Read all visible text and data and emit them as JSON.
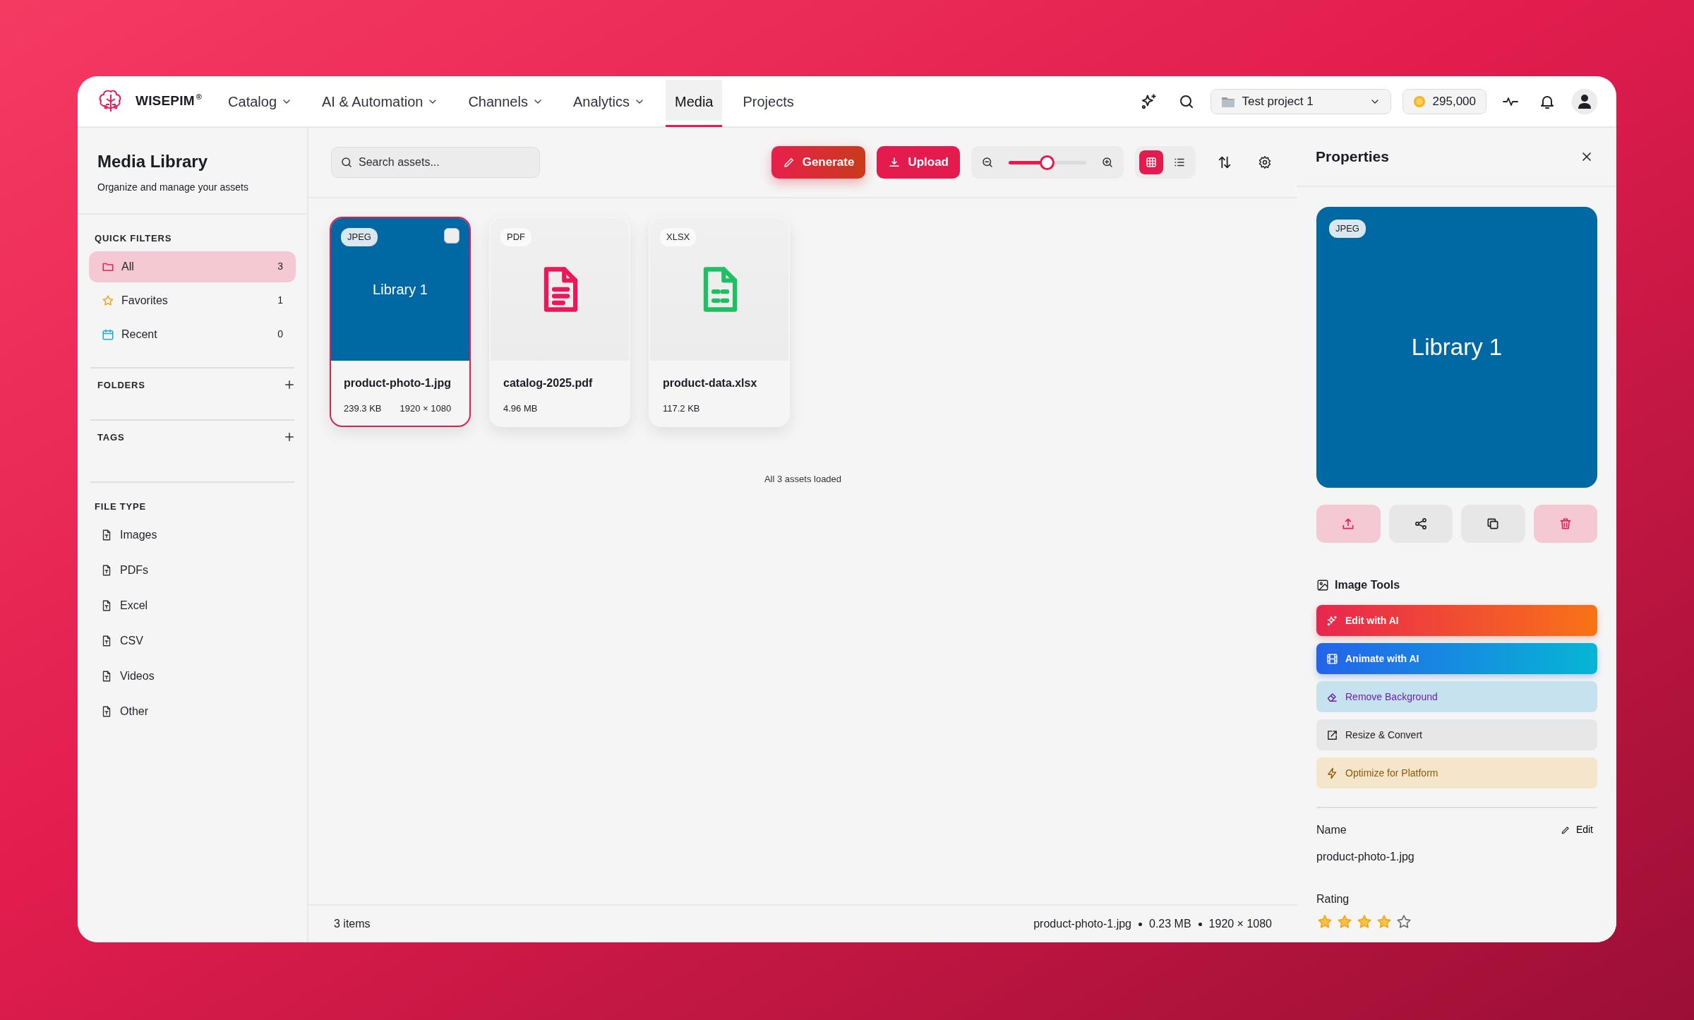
{
  "brand": {
    "name": "WISEPIM",
    "mark": "®"
  },
  "nav": [
    {
      "label": "Catalog",
      "dropdown": true,
      "selected": false
    },
    {
      "label": "AI & Automation",
      "dropdown": true,
      "selected": false
    },
    {
      "label": "Channels",
      "dropdown": true,
      "selected": false
    },
    {
      "label": "Analytics",
      "dropdown": true,
      "selected": false
    },
    {
      "label": "Media",
      "dropdown": false,
      "selected": true
    },
    {
      "label": "Projects",
      "dropdown": false,
      "selected": false
    }
  ],
  "project_select": {
    "value": "Test project 1"
  },
  "credits": "295,000",
  "sidebar": {
    "title": "Media Library",
    "subtitle": "Organize and manage your assets",
    "quick_filters": {
      "heading": "QUICK FILTERS",
      "items": [
        {
          "label": "All",
          "count": "3",
          "kind": "folder",
          "selected": true
        },
        {
          "label": "Favorites",
          "count": "1",
          "kind": "star",
          "selected": false
        },
        {
          "label": "Recent",
          "count": "0",
          "kind": "calendar",
          "selected": false
        }
      ]
    },
    "folders": {
      "heading": "FOLDERS"
    },
    "tags": {
      "heading": "TAGS"
    },
    "file_types": {
      "heading": "FILE TYPE",
      "items": [
        {
          "label": "Images",
          "selected": false
        },
        {
          "label": "PDFs",
          "selected": false
        },
        {
          "label": "Excel",
          "selected": false
        },
        {
          "label": "CSV",
          "selected": false
        },
        {
          "label": "Videos",
          "selected": false
        },
        {
          "label": "Other",
          "selected": false
        }
      ]
    }
  },
  "toolbar": {
    "search": {
      "placeholder": "Search assets..."
    },
    "generate": "Generate",
    "upload": "Upload",
    "zoom": {
      "level": 0.5
    },
    "views": [
      {
        "kind": "grid",
        "selected": true
      },
      {
        "kind": "list",
        "selected": false
      }
    ]
  },
  "assets": [
    {
      "type": "JPEG",
      "kind": "image",
      "preview_text": "Library 1",
      "name": "product-photo-1.jpg",
      "size": "239.3 KB",
      "dimensions": "1920 × 1080",
      "selected": true,
      "checked": false
    },
    {
      "type": "PDF",
      "kind": "pdf",
      "name": "catalog-2025.pdf",
      "size": "4.96 MB",
      "selected": false,
      "checked": false
    },
    {
      "type": "XLSX",
      "kind": "sheet",
      "name": "product-data.xlsx",
      "size": "117.2 KB",
      "selected": false,
      "checked": false
    }
  ],
  "load_status": "All 3 assets loaded",
  "status_bar": {
    "count": "3 items",
    "file": "product-photo-1.jpg",
    "size": "0.23 MB",
    "dimensions": "1920 × 1080"
  },
  "properties": {
    "title": "Properties",
    "preview": {
      "type": "JPEG",
      "text": "Library 1"
    },
    "actions": [
      {
        "kind": "upload"
      },
      {
        "kind": "share"
      },
      {
        "kind": "copy"
      },
      {
        "kind": "delete"
      }
    ],
    "tools_heading": "Image Tools",
    "tools": [
      {
        "label": "Edit with AI",
        "kind": "edit-ai"
      },
      {
        "label": "Animate with AI",
        "kind": "animate-ai"
      },
      {
        "label": "Remove Background",
        "kind": "remove-bg"
      },
      {
        "label": "Resize & Convert",
        "kind": "resize"
      },
      {
        "label": "Optimize for Platform",
        "kind": "optimize"
      }
    ],
    "name_label": "Name",
    "edit_label": "Edit",
    "name_value": "product-photo-1.jpg",
    "rating_label": "Rating",
    "stars": 4
  }
}
